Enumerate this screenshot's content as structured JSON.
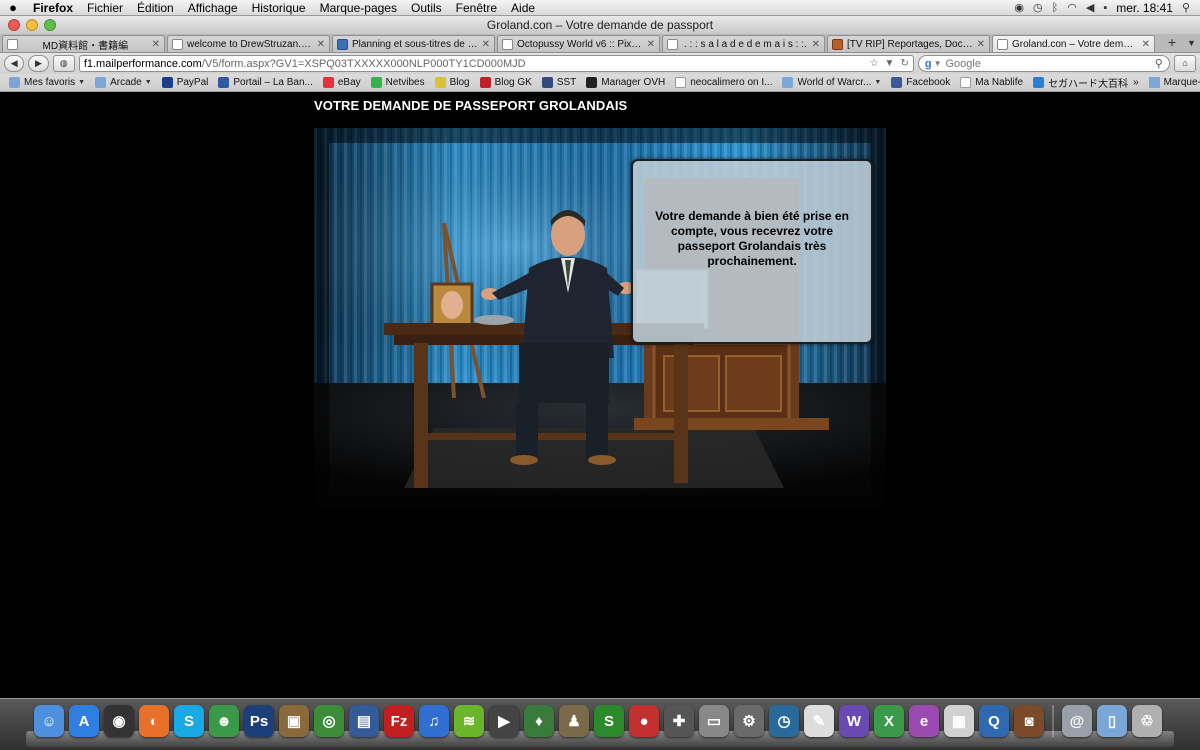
{
  "menubar": {
    "items": [
      "Firefox",
      "Fichier",
      "Édition",
      "Affichage",
      "Historique",
      "Marque-pages",
      "Outils",
      "Fenêtre",
      "Aide"
    ],
    "clock": "mer. 18:41"
  },
  "window": {
    "title": "Groland.con – Votre demande de passport"
  },
  "tabs": [
    {
      "label": "MD資料館・書籍編",
      "active": false
    },
    {
      "label": "welcome to DrewStruzan.com",
      "active": false
    },
    {
      "label": "Planning et sous-titres de la...",
      "active": false
    },
    {
      "label": "Octopussy World v6 :: Pixel ...",
      "active": false
    },
    {
      "label": ". : : s a l a d e d e m a i s : :.",
      "active": false
    },
    {
      "label": "[TV RIP] Reportages, Docum...",
      "active": false
    },
    {
      "label": "Groland.con – Votre demand...",
      "active": true
    }
  ],
  "nav": {
    "url_host": "f1.mailperformance.com",
    "url_path": "/V5/form.aspx?GV1=XSPQ03TXXXXX000NLP000TY1CD000MJD",
    "search_placeholder": "Google"
  },
  "bookmarks": [
    {
      "label": "Mes favoris",
      "caret": true,
      "icon": "folder-icon",
      "color": "#7aa7d8"
    },
    {
      "label": "Arcade",
      "caret": true,
      "icon": "folder-icon",
      "color": "#7aa7d8"
    },
    {
      "label": "PayPal",
      "caret": false,
      "icon": "paypal-icon",
      "color": "#1c3d8c"
    },
    {
      "label": "Portail – La Ban...",
      "caret": false,
      "icon": "bank-icon",
      "color": "#2d5aa0"
    },
    {
      "label": "eBay",
      "caret": false,
      "icon": "ebay-icon",
      "color": "#e53238"
    },
    {
      "label": "Netvibes",
      "caret": false,
      "icon": "netvibes-icon",
      "color": "#36b24a"
    },
    {
      "label": "Blog",
      "caret": false,
      "icon": "blog-icon",
      "color": "#d9c23a"
    },
    {
      "label": "Blog GK",
      "caret": false,
      "icon": "blog-gk-icon",
      "color": "#c0202a"
    },
    {
      "label": "SST",
      "caret": false,
      "icon": "sst-icon",
      "color": "#334a7a"
    },
    {
      "label": "Manager OVH",
      "caret": false,
      "icon": "ovh-icon",
      "color": "#222222"
    },
    {
      "label": "neocalimero on I...",
      "caret": false,
      "icon": "page-icon",
      "color": "#ffffff"
    },
    {
      "label": "World of Warcr...",
      "caret": true,
      "icon": "folder-icon",
      "color": "#7aa7d8"
    },
    {
      "label": "Facebook",
      "caret": false,
      "icon": "facebook-icon",
      "color": "#3b5998"
    },
    {
      "label": "Ma Nablife",
      "caret": false,
      "icon": "page-icon",
      "color": "#ffffff"
    },
    {
      "label": "セガハード大百科",
      "caret": false,
      "icon": "sega-icon",
      "color": "#2a7fd4"
    }
  ],
  "bookmarks_more": "Marque-pages",
  "page": {
    "heading": "VOTRE DEMANDE DE PASSEPORT GROLANDAIS",
    "message": "Votre demande à bien été prise en compte, vous recevrez votre passeport Grolandais très prochainement."
  },
  "dock": [
    {
      "name": "finder-icon",
      "color": "#4f8fe0",
      "glyph": "☺"
    },
    {
      "name": "app-store-icon",
      "color": "#2f7fe0",
      "glyph": "A"
    },
    {
      "name": "dashboard-icon",
      "color": "#333333",
      "glyph": "◉"
    },
    {
      "name": "firefox-icon",
      "color": "#e8702a",
      "glyph": "◐"
    },
    {
      "name": "skype-icon",
      "color": "#19a9e5",
      "glyph": "S"
    },
    {
      "name": "messenger-icon",
      "color": "#3a9a4a",
      "glyph": "☻"
    },
    {
      "name": "photoshop-icon",
      "color": "#1c3f7a",
      "glyph": "Ps"
    },
    {
      "name": "preview-icon",
      "color": "#8a6a3a",
      "glyph": "▣"
    },
    {
      "name": "chrome-icon",
      "color": "#3c8c3c",
      "glyph": "◎"
    },
    {
      "name": "books-icon",
      "color": "#355a9a",
      "glyph": "▤"
    },
    {
      "name": "filezilla-icon",
      "color": "#c22020",
      "glyph": "Fz"
    },
    {
      "name": "itunes-icon",
      "color": "#2f6fd0",
      "glyph": "♫"
    },
    {
      "name": "spotify-icon",
      "color": "#6ab52a",
      "glyph": "≋"
    },
    {
      "name": "clapper-icon",
      "color": "#444444",
      "glyph": "▶"
    },
    {
      "name": "leaf-icon",
      "color": "#3a7a3a",
      "glyph": "♦"
    },
    {
      "name": "automator-icon",
      "color": "#7a6a4a",
      "glyph": "♟"
    },
    {
      "name": "scrivener-icon",
      "color": "#2c8a2c",
      "glyph": "S"
    },
    {
      "name": "pin-icon",
      "color": "#c23030",
      "glyph": "●"
    },
    {
      "name": "gamepad-icon",
      "color": "#555555",
      "glyph": "✚"
    },
    {
      "name": "disk-icon",
      "color": "#888888",
      "glyph": "▭"
    },
    {
      "name": "system-preferences-icon",
      "color": "#6a6a6a",
      "glyph": "⚙"
    },
    {
      "name": "time-machine-icon",
      "color": "#2a6a9a",
      "glyph": "◷"
    },
    {
      "name": "textedit-icon",
      "color": "#dddddd",
      "glyph": "✎"
    },
    {
      "name": "word-icon",
      "color": "#6a4ab0",
      "glyph": "W"
    },
    {
      "name": "excel-icon",
      "color": "#3a9a4a",
      "glyph": "X"
    },
    {
      "name": "entourage-icon",
      "color": "#9a4ab0",
      "glyph": "e"
    },
    {
      "name": "calendar-icon",
      "color": "#d0d0d0",
      "glyph": "▦"
    },
    {
      "name": "quicktime-icon",
      "color": "#2f6ab0",
      "glyph": "Q"
    },
    {
      "name": "photo-booth-icon",
      "color": "#7a4a2a",
      "glyph": "◙"
    },
    {
      "name": "mail-icon",
      "color": "#9aa0aa",
      "glyph": "@"
    },
    {
      "name": "documents-folder-icon",
      "color": "#7aa7d8",
      "glyph": "▯"
    },
    {
      "name": "trash-icon",
      "color": "#b0b0b0",
      "glyph": "♲"
    }
  ]
}
